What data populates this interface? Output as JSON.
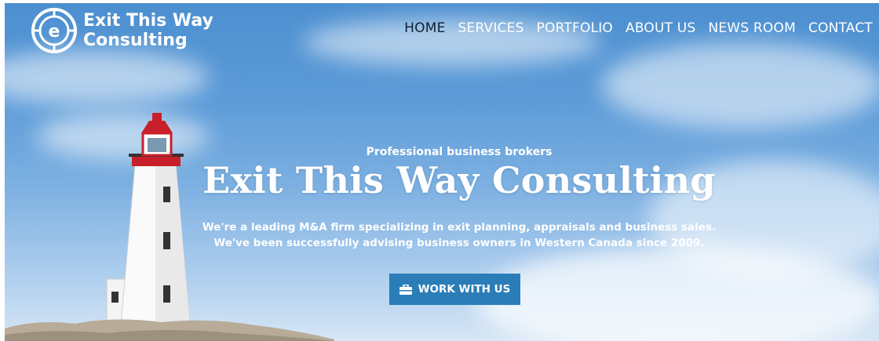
{
  "brand": {
    "name_line1": "Exit This Way",
    "name_line2": "Consulting",
    "logo_icon": "compass-e-icon"
  },
  "nav": {
    "items": [
      {
        "label": "HOME",
        "active": true
      },
      {
        "label": "SERVICES",
        "active": false
      },
      {
        "label": "PORTFOLIO",
        "active": false
      },
      {
        "label": "ABOUT US",
        "active": false
      },
      {
        "label": "NEWS ROOM",
        "active": false
      },
      {
        "label": "CONTACT",
        "active": false
      }
    ]
  },
  "hero": {
    "eyebrow": "Professional business brokers",
    "title": "Exit This Way Consulting",
    "description_line1": "We're a leading M&A firm specializing in exit planning, appraisals and business sales.",
    "description_line2": "We've been successfully advising business owners in Western Canada since 2009.",
    "cta_label": "WORK WITH US",
    "cta_icon": "briefcase-icon"
  },
  "colors": {
    "cta": "#2b7db8",
    "active_nav": "#0f1f33",
    "lighthouse_red": "#c8202a"
  }
}
